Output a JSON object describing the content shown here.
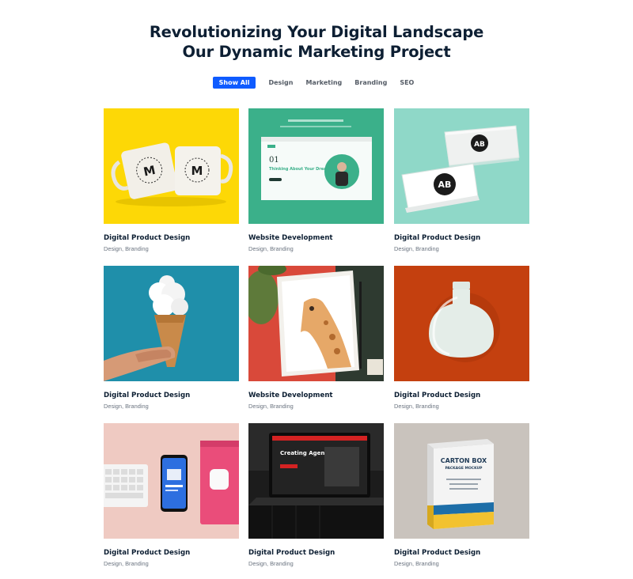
{
  "header": {
    "title_line1": "Revolutionizing Your Digital Landscape",
    "title_line2": "Our Dynamic Marketing Project"
  },
  "filters": [
    "Show All",
    "Design",
    "Marketing",
    "Branding",
    "SEO"
  ],
  "active_filter": "Show All",
  "colors": {
    "accent": "#0f5bff",
    "heading": "#0d1f33",
    "muted": "#6b7480"
  },
  "projects": [
    {
      "title": "Digital Product Design",
      "tags": "Design, Branding",
      "image": "mugs-on-yellow"
    },
    {
      "title": "Website Development",
      "tags": "Design, Branding",
      "image": "website-mockup-on-green"
    },
    {
      "title": "Digital Product Design",
      "tags": "Design, Branding",
      "image": "business-cards-on-mint"
    },
    {
      "title": "Digital Product Design",
      "tags": "Design, Branding",
      "image": "cloud-ice-cream-cone"
    },
    {
      "title": "Website Development",
      "tags": "Design, Branding",
      "image": "giraffe-illustration"
    },
    {
      "title": "Digital Product Design",
      "tags": "Design, Branding",
      "image": "white-bottle-on-orange"
    },
    {
      "title": "Digital Product Design",
      "tags": "Design, Branding",
      "image": "keyboard-phone-airpods"
    },
    {
      "title": "Digital Product Design",
      "tags": "Design, Branding",
      "image": "laptop-creating-agency"
    },
    {
      "title": "Digital Product Design",
      "tags": "Design, Branding",
      "image": "carton-box-mockup"
    }
  ],
  "image_text": {
    "mug_letter": "M",
    "card_logo": "AB",
    "website_number": "01",
    "website_headline": "Thinking About Your Dreams?",
    "laptop_headline": "Creating Agency Based",
    "box_title": "CARTON BOX",
    "box_subtitle": "PACKAGE MOCKUP"
  }
}
